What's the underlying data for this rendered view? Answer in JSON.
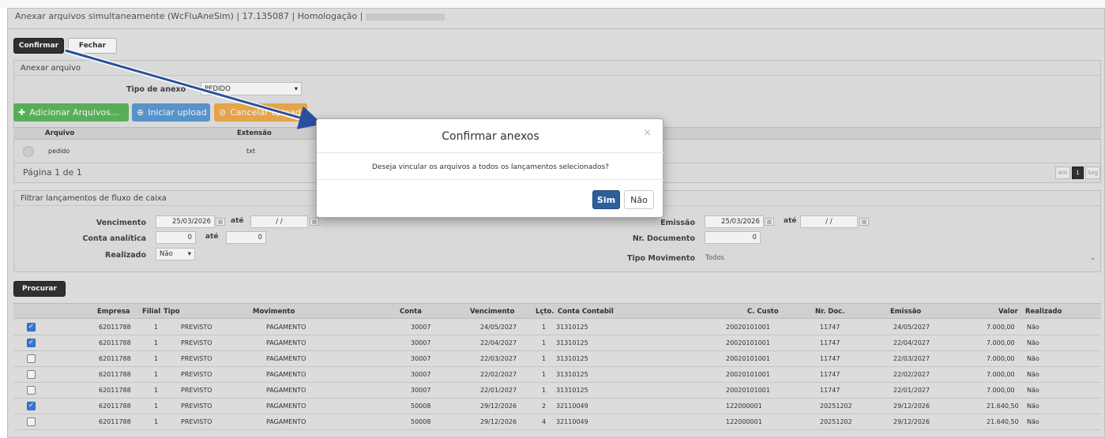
{
  "window": {
    "title": "Anexar arquivos simultaneamente (WcFluAneSim) | 17.135087 | Homologação |"
  },
  "toolbar": {
    "confirm_label": "Confirmar",
    "close_label": "Fechar"
  },
  "attach": {
    "panel_title": "Anexar arquivo",
    "type_label": "Tipo de anexo",
    "type_value": "PEDIDO",
    "add_files": "Adicionar Arquivos...",
    "start_upload": "Iniciar upload",
    "cancel_upload": "Cancelar upload",
    "col_arquivo": "Arquivo",
    "col_extensao": "Extensão",
    "file_name": "pedido",
    "file_ext": "txt",
    "page_info": "Página 1 de 1",
    "prev": "Ant",
    "page": "1",
    "next": "Seg"
  },
  "filter": {
    "panel_title": "Filtrar lançamentos de fluxo de caixa",
    "vencimento_label": "Vencimento",
    "vencimento_from": "25/03/2026",
    "vencimento_to": "/ /",
    "ate": "até",
    "conta_label": "Conta analítica",
    "conta_from": "0",
    "conta_to": "0",
    "realizado_label": "Realizado",
    "realizado_value": "Não",
    "emissao_label": "Emissão",
    "emissao_from": "25/03/2026",
    "emissao_to": "/ /",
    "nrdoc_label": "Nr. Documento",
    "nrdoc_value": "0",
    "tipomov_label": "Tipo Movimento",
    "tipomov_value": "Todos"
  },
  "search_label": "Procurar",
  "table": {
    "headers": [
      "Empresa",
      "Filial",
      "Tipo",
      "Movimento",
      "Conta",
      "Vencimento",
      "Lçto.",
      "Conta Contabil",
      "C. Custo",
      "Nr. Doc.",
      "Emissão",
      "Valor",
      "Realizado"
    ],
    "rows": [
      {
        "checked": true,
        "empresa": "62011788",
        "filial": "1",
        "tipo": "PREVISTO",
        "movimento": "PAGAMENTO",
        "conta": "30007",
        "vencimento": "24/05/2027",
        "lcto": "1",
        "contabil": "31310125",
        "custo": "20020101001",
        "nrdoc": "11747",
        "emissao": "24/05/2027",
        "valor": "7.000,00",
        "realizado": "Não"
      },
      {
        "checked": true,
        "empresa": "62011788",
        "filial": "1",
        "tipo": "PREVISTO",
        "movimento": "PAGAMENTO",
        "conta": "30007",
        "vencimento": "22/04/2027",
        "lcto": "1",
        "contabil": "31310125",
        "custo": "20020101001",
        "nrdoc": "11747",
        "emissao": "22/04/2027",
        "valor": "7.000,00",
        "realizado": "Não"
      },
      {
        "checked": false,
        "empresa": "62011788",
        "filial": "1",
        "tipo": "PREVISTO",
        "movimento": "PAGAMENTO",
        "conta": "30007",
        "vencimento": "22/03/2027",
        "lcto": "1",
        "contabil": "31310125",
        "custo": "20020101001",
        "nrdoc": "11747",
        "emissao": "22/03/2027",
        "valor": "7.000,00",
        "realizado": "Não"
      },
      {
        "checked": false,
        "empresa": "62011788",
        "filial": "1",
        "tipo": "PREVISTO",
        "movimento": "PAGAMENTO",
        "conta": "30007",
        "vencimento": "22/02/2027",
        "lcto": "1",
        "contabil": "31310125",
        "custo": "20020101001",
        "nrdoc": "11747",
        "emissao": "22/02/2027",
        "valor": "7.000,00",
        "realizado": "Não"
      },
      {
        "checked": false,
        "empresa": "62011788",
        "filial": "1",
        "tipo": "PREVISTO",
        "movimento": "PAGAMENTO",
        "conta": "30007",
        "vencimento": "22/01/2027",
        "lcto": "1",
        "contabil": "31310125",
        "custo": "20020101001",
        "nrdoc": "11747",
        "emissao": "22/01/2027",
        "valor": "7.000,00",
        "realizado": "Não"
      },
      {
        "checked": true,
        "empresa": "62011788",
        "filial": "1",
        "tipo": "PREVISTO",
        "movimento": "PAGAMENTO",
        "conta": "50008",
        "vencimento": "29/12/2026",
        "lcto": "2",
        "contabil": "32110049",
        "custo": "122000001",
        "nrdoc": "20251202",
        "emissao": "29/12/2026",
        "valor": "21.640,50",
        "realizado": "Não"
      },
      {
        "checked": false,
        "empresa": "62011788",
        "filial": "1",
        "tipo": "PREVISTO",
        "movimento": "PAGAMENTO",
        "conta": "50008",
        "vencimento": "29/12/2026",
        "lcto": "4",
        "contabil": "32110049",
        "custo": "122000001",
        "nrdoc": "20251202",
        "emissao": "29/12/2026",
        "valor": "21.640,50",
        "realizado": "Não"
      }
    ]
  },
  "modal": {
    "title": "Confirmar anexos",
    "message": "Deseja vincular os arquivos a todos os lançamentos selecionados?",
    "yes": "Sim",
    "no": "Não",
    "close": "×"
  },
  "colors": {
    "green": "#5cb85c",
    "blue": "#5b9bd5",
    "orange": "#f0ad4e",
    "primary": "#2d5f9a",
    "arrow": "#2a4f9e"
  }
}
